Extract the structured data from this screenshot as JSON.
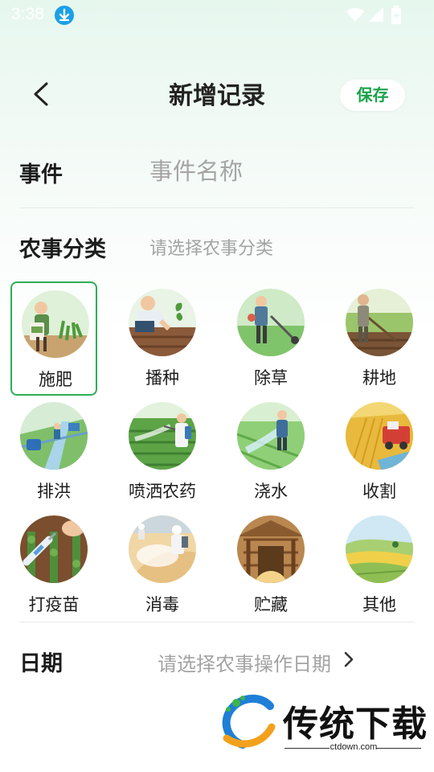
{
  "status_bar": {
    "time": "3:38"
  },
  "header": {
    "title": "新增记录",
    "save_label": "保存"
  },
  "event": {
    "label": "事件",
    "placeholder": "事件名称",
    "value": ""
  },
  "category": {
    "label": "农事分类",
    "placeholder": "请选择农事分类",
    "selected": "施肥",
    "items": [
      {
        "label": "施肥",
        "icon": "fertilize-illustration"
      },
      {
        "label": "播种",
        "icon": "sowing-illustration"
      },
      {
        "label": "除草",
        "icon": "weeding-illustration"
      },
      {
        "label": "耕地",
        "icon": "plowing-illustration"
      },
      {
        "label": "排洪",
        "icon": "drainage-illustration"
      },
      {
        "label": "喷洒农药",
        "icon": "spray-pesticide-illustration"
      },
      {
        "label": "浇水",
        "icon": "watering-illustration"
      },
      {
        "label": "收割",
        "icon": "harvest-illustration"
      },
      {
        "label": "打疫苗",
        "icon": "vaccine-illustration"
      },
      {
        "label": "消毒",
        "icon": "disinfect-illustration"
      },
      {
        "label": "贮藏",
        "icon": "storage-illustration"
      },
      {
        "label": "其他",
        "icon": "other-landscape-illustration"
      }
    ]
  },
  "date": {
    "label": "日期",
    "placeholder": "请选择农事操作日期"
  },
  "watermark": {
    "brand": "传统下载",
    "url": "ctdown.com"
  },
  "colors": {
    "accent": "#1aa24a",
    "selected_border": "#2fae55",
    "placeholder": "#a3a3a3"
  }
}
